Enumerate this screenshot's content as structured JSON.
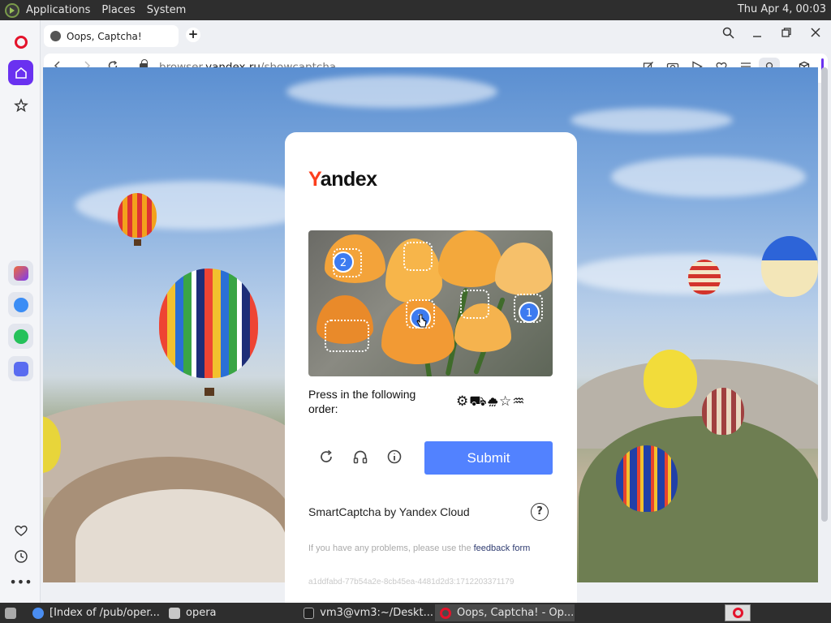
{
  "system_bar": {
    "menus": [
      "Applications",
      "Places",
      "System"
    ],
    "clock": "Thu Apr  4, 00:03"
  },
  "browser": {
    "tab": {
      "title": "Oops, Captcha!"
    },
    "new_tab_label": "+",
    "address": {
      "prefix": "browser.",
      "domain": "yandex.ru",
      "path": "/showcaptcha"
    },
    "accent_color": "#6a31f0"
  },
  "captcha": {
    "logo_first": "Y",
    "logo_rest": "andex",
    "prompt": "Press in the following order:",
    "sequence_icons": "⚙⛟⛆☆♒",
    "markers": [
      "2",
      "3",
      "1"
    ],
    "submit_label": "Submit",
    "brand": "SmartCaptcha by Yandex Cloud",
    "help_label": "?",
    "problem_text": "If you have any problems, please use the ",
    "feedback_link": "feedback form",
    "request_id": "a1ddfabd-77b54a2e-8cb45ea-4481d2d3:1712203371179",
    "submit_color": "#5282ff"
  },
  "taskbar": {
    "items": [
      {
        "label": "[Index of /pub/oper..."
      },
      {
        "label": "opera"
      },
      {
        "label": "vm3@vm3:~/Deskt..."
      },
      {
        "label": "Oops, Captcha! - Op..."
      }
    ]
  }
}
